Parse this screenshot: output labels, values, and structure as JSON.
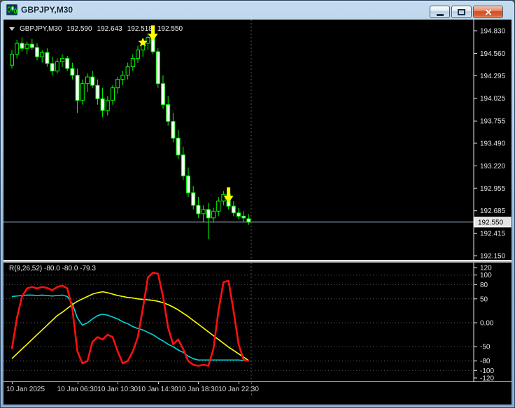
{
  "window": {
    "title": "GBPJPY,M30"
  },
  "chart": {
    "info": {
      "symbol": "GBPJPY,M30",
      "open": "192.590",
      "high": "192.643",
      "low": "192.518",
      "close": "192.550"
    },
    "price_badge": "192.550"
  },
  "indicator": {
    "label": "R(9,26,52) -80.0 -80.0 -79.3"
  },
  "chart_data": {
    "type": "candlestick",
    "title": "GBPJPY M30 price chart with oscillator subwindow",
    "symbol": "GBPJPY",
    "timeframe": "M30",
    "price_axis": {
      "max": 194.83,
      "min": 192.15,
      "current": 192.55,
      "ticks": [
        "194.830",
        "194.560",
        "194.295",
        "194.025",
        "193.755",
        "193.490",
        "193.220",
        "192.955",
        "192.685",
        "192.415",
        "192.150"
      ]
    },
    "time_axis": [
      {
        "label": "10 Jan 2025",
        "index": 0
      },
      {
        "label": "10 Jan 06:30",
        "index": 13
      },
      {
        "label": "10 Jan 10:30",
        "index": 21
      },
      {
        "label": "10 Jan 14:30",
        "index": 29
      },
      {
        "label": "10 Jan 18:30",
        "index": 37
      },
      {
        "label": "10 Jan 22:30",
        "index": 45
      }
    ],
    "candles": [
      [
        194.42,
        194.6,
        194.38,
        194.55
      ],
      [
        194.55,
        194.72,
        194.5,
        194.68
      ],
      [
        194.68,
        194.75,
        194.58,
        194.62
      ],
      [
        194.62,
        194.7,
        194.55,
        194.67
      ],
      [
        194.67,
        194.73,
        194.6,
        194.63
      ],
      [
        194.63,
        194.68,
        194.48,
        194.52
      ],
      [
        194.52,
        194.6,
        194.45,
        194.57
      ],
      [
        194.57,
        194.62,
        194.4,
        194.44
      ],
      [
        194.44,
        194.52,
        194.3,
        194.35
      ],
      [
        194.35,
        194.5,
        194.32,
        194.46
      ],
      [
        194.46,
        194.55,
        194.4,
        194.5
      ],
      [
        194.5,
        194.53,
        194.35,
        194.38
      ],
      [
        194.38,
        194.45,
        194.25,
        194.3
      ],
      [
        194.3,
        194.38,
        193.85,
        194.0
      ],
      [
        194.0,
        194.25,
        193.95,
        194.2
      ],
      [
        194.2,
        194.32,
        194.1,
        194.28
      ],
      [
        194.28,
        194.35,
        194.15,
        194.18
      ],
      [
        194.18,
        194.25,
        193.95,
        194.02
      ],
      [
        194.02,
        194.15,
        193.8,
        193.88
      ],
      [
        193.88,
        194.05,
        193.82,
        194.0
      ],
      [
        194.0,
        194.18,
        193.95,
        194.15
      ],
      [
        194.15,
        194.28,
        194.08,
        194.25
      ],
      [
        194.25,
        194.35,
        194.18,
        194.3
      ],
      [
        194.3,
        194.45,
        194.25,
        194.4
      ],
      [
        194.4,
        194.55,
        194.35,
        194.5
      ],
      [
        194.5,
        194.65,
        194.45,
        194.6
      ],
      [
        194.6,
        194.72,
        194.52,
        194.68
      ],
      [
        194.68,
        194.8,
        194.6,
        194.75
      ],
      [
        194.75,
        194.78,
        194.55,
        194.58
      ],
      [
        194.58,
        194.62,
        194.15,
        194.2
      ],
      [
        194.2,
        194.3,
        193.9,
        193.95
      ],
      [
        193.95,
        194.05,
        193.7,
        193.75
      ],
      [
        193.75,
        193.85,
        193.5,
        193.55
      ],
      [
        193.55,
        193.65,
        193.3,
        193.35
      ],
      [
        193.35,
        193.45,
        193.05,
        193.1
      ],
      [
        193.1,
        193.2,
        192.85,
        192.9
      ],
      [
        192.9,
        192.98,
        192.7,
        192.75
      ],
      [
        192.75,
        192.85,
        192.6,
        192.65
      ],
      [
        192.65,
        192.75,
        192.55,
        192.7
      ],
      [
        192.7,
        192.78,
        192.35,
        192.6
      ],
      [
        192.6,
        192.72,
        192.55,
        192.68
      ],
      [
        192.68,
        192.85,
        192.62,
        192.8
      ],
      [
        192.8,
        192.92,
        192.75,
        192.88
      ],
      [
        192.88,
        192.9,
        192.7,
        192.74
      ],
      [
        192.74,
        192.8,
        192.62,
        192.66
      ],
      [
        192.66,
        192.72,
        192.58,
        192.62
      ],
      [
        192.62,
        192.68,
        192.55,
        192.6
      ],
      [
        192.59,
        192.643,
        192.518,
        192.55
      ]
    ],
    "signals": [
      {
        "shape": "star",
        "index": 26,
        "price": 194.69
      },
      {
        "shape": "arrow-down",
        "index": 28,
        "price": 194.71
      },
      {
        "shape": "arrow-down",
        "index": 43,
        "price": 192.78
      }
    ],
    "oscillator": {
      "name": "R(9,26,52)",
      "current_values": [
        "-80.0",
        "-80.0",
        "-79.3"
      ],
      "range": [
        -120,
        120
      ],
      "levels": [
        100,
        80,
        50,
        0,
        -50,
        -80,
        -100
      ],
      "axis_ticks": [
        "120",
        "100",
        "80",
        "50",
        "0.00",
        "-50",
        "-80",
        "-100",
        "-120"
      ],
      "series": [
        {
          "name": "cyan-line",
          "color": "#00d8d8",
          "width": 1.6,
          "values": [
            55,
            56,
            57,
            58,
            58,
            57,
            58,
            57,
            56,
            57,
            58,
            55,
            40,
            10,
            -5,
            0,
            8,
            15,
            18,
            16,
            12,
            8,
            2,
            -2,
            -8,
            -12,
            -15,
            -20,
            -25,
            -32,
            -38,
            -45,
            -50,
            -57,
            -62,
            -70,
            -75,
            -78,
            -78,
            -78,
            -78,
            -78,
            -78,
            -78,
            -78,
            -78,
            -79,
            -80
          ]
        },
        {
          "name": "yellow-line",
          "color": "#ffff00",
          "width": 1.6,
          "values": [
            -75,
            -65,
            -55,
            -45,
            -35,
            -25,
            -15,
            -5,
            5,
            15,
            22,
            30,
            38,
            45,
            50,
            55,
            60,
            63,
            65,
            63,
            60,
            57,
            55,
            53,
            52,
            50,
            49,
            48,
            47,
            45,
            42,
            38,
            33,
            27,
            20,
            13,
            5,
            -3,
            -11,
            -19,
            -27,
            -35,
            -43,
            -51,
            -58,
            -65,
            -72,
            -79
          ]
        },
        {
          "name": "red-line",
          "color": "#ff1010",
          "width": 2.6,
          "values": [
            -55,
            10,
            55,
            72,
            75,
            72,
            75,
            73,
            68,
            75,
            78,
            72,
            30,
            -60,
            -85,
            -80,
            -40,
            -30,
            -35,
            -25,
            -30,
            -60,
            -85,
            -80,
            -60,
            -30,
            30,
            95,
            105,
            103,
            55,
            -10,
            -45,
            -35,
            -55,
            -80,
            -88,
            -90,
            -88,
            -90,
            -55,
            25,
            85,
            88,
            25,
            -45,
            -78,
            -80
          ]
        }
      ]
    },
    "colors": {
      "background": "#000000",
      "candle_outline": "#00ff00",
      "bull_body": "#000000",
      "bear_body": "#ffffff",
      "bid_line": "#8fa8b8",
      "grid": "#5a5a5a",
      "axis_text": "#e4e4e4",
      "signal": "#ffff00"
    }
  }
}
